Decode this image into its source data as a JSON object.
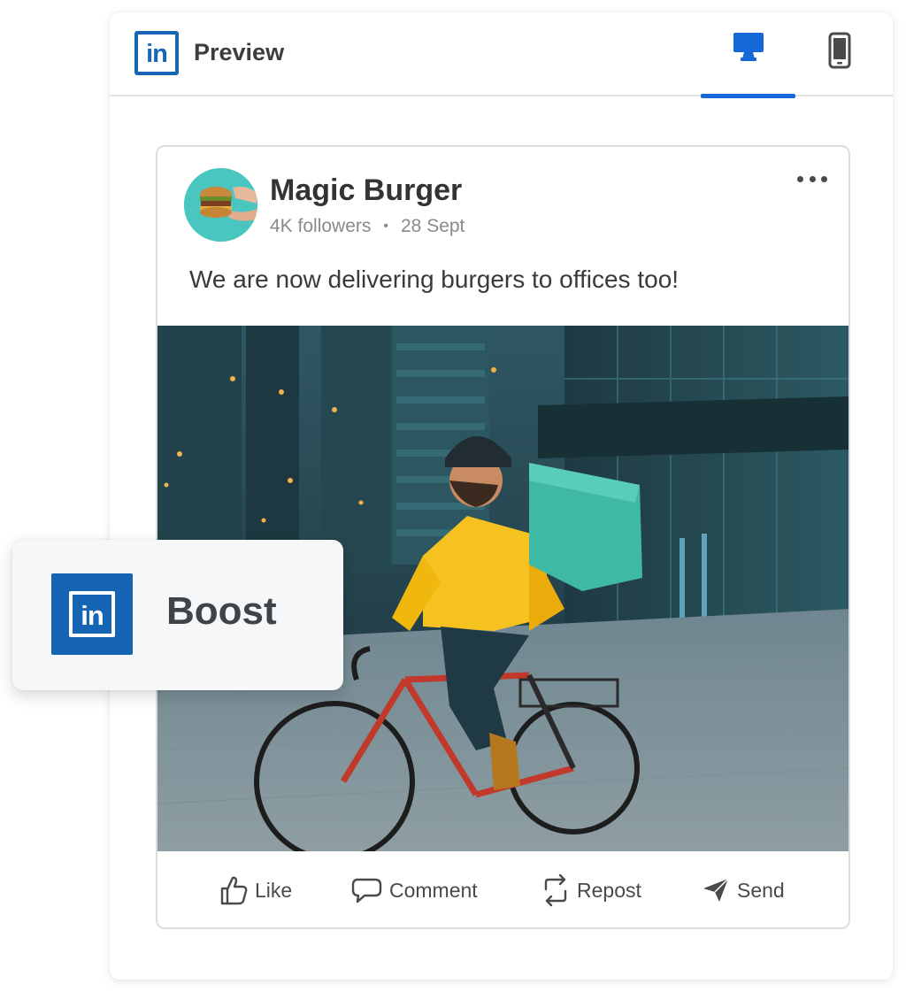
{
  "header": {
    "logo_text": "in",
    "title": "Preview",
    "views": [
      {
        "name": "desktop",
        "icon": "desktop-icon",
        "active": true
      },
      {
        "name": "mobile",
        "icon": "mobile-icon",
        "active": false
      }
    ]
  },
  "post": {
    "author": "Magic Burger",
    "followers": "4K followers",
    "separator": "•",
    "date": "28 Sept",
    "text": "We are now delivering burgers to offices too!",
    "more_icon": "more-horizontal-icon"
  },
  "actions": [
    {
      "label": "Like",
      "icon": "thumbs-up-icon"
    },
    {
      "label": "Comment",
      "icon": "comment-icon"
    },
    {
      "label": "Repost",
      "icon": "repost-icon"
    },
    {
      "label": "Send",
      "icon": "send-icon"
    }
  ],
  "boost": {
    "logo_text": "in",
    "label": "Boost"
  },
  "colors": {
    "brand_blue": "#1667b6",
    "active_tab": "#1667d8",
    "avatar_bg": "#49c6c0",
    "text_dark": "#333333",
    "text_muted": "#8a8a8a"
  }
}
